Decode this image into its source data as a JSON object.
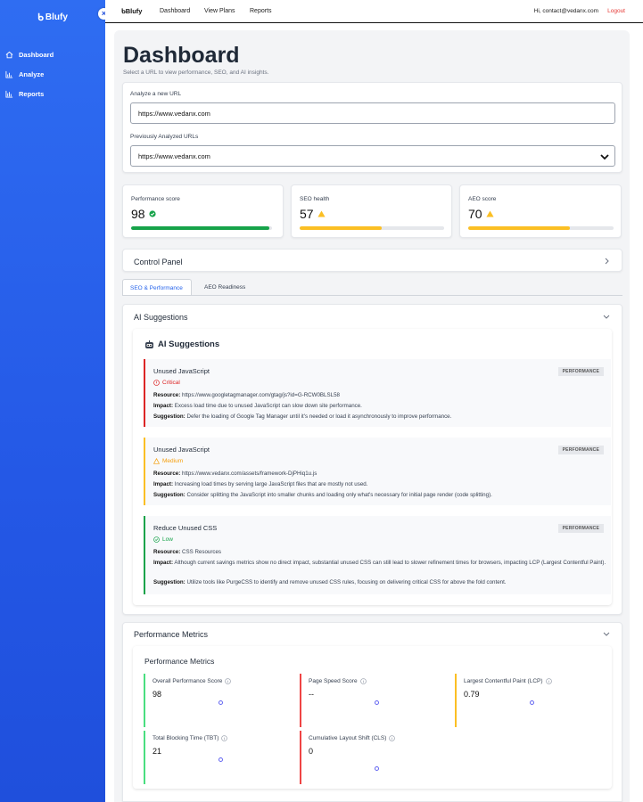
{
  "sidebar": {
    "logo": "Blufy",
    "close": "×",
    "items": [
      {
        "label": "Dashboard",
        "icon": "home-icon"
      },
      {
        "label": "Analyze",
        "icon": "bar-chart-icon"
      },
      {
        "label": "Reports",
        "icon": "bar-chart-icon"
      }
    ]
  },
  "topnav": {
    "logo": "Blufy",
    "links": [
      "Dashboard",
      "View Plans",
      "Reports"
    ],
    "user": "Hi, contact@vedanx.com",
    "logout": "Logout"
  },
  "page": {
    "title": "Dashboard",
    "subtitle": "Select a URL to view performance, SEO, and AI insights."
  },
  "analyze": {
    "new_label": "Analyze a new URL",
    "new_value": "https://www.vedanx.com",
    "prev_label": "Previously Analyzed URLs",
    "prev_value": "https://www.vedanx.com"
  },
  "scores": [
    {
      "label": "Performance score",
      "value": "98",
      "status": "good",
      "fill": 0.98,
      "color": "#16a34a"
    },
    {
      "label": "SEO health",
      "value": "57",
      "status": "warn",
      "fill": 0.57,
      "color": "#fbbf24"
    },
    {
      "label": "AEO score",
      "value": "70",
      "status": "warn",
      "fill": 0.7,
      "color": "#fbbf24"
    }
  ],
  "control_panel": {
    "title": "Control Panel"
  },
  "tabs": [
    "SEO & Performance",
    "AEO Readiness"
  ],
  "ai_section": {
    "title": "AI Suggestions",
    "inner_title": "AI Suggestions",
    "suggestions": [
      {
        "title": "Unused JavaScript",
        "severity": "Critical",
        "color": "#dc2626",
        "tag": "PERFORMANCE",
        "resource_label": "Resource:",
        "resource": "https://www.googletagmanager.com/gtag/js?id=G-RCW0BLSL58",
        "impact_label": "Impact:",
        "impact": "Excess load time due to unused JavaScript can slow down site performance.",
        "suggestion_label": "Suggestion:",
        "suggestion": "Defer the loading of Google Tag Manager until it's needed or load it asynchronously to improve performance."
      },
      {
        "title": "Unused JavaScript",
        "severity": "Medium",
        "color": "#fbbf24",
        "tag": "PERFORMANCE",
        "resource_label": "Resource:",
        "resource": "https://www.vedanx.com/assets/framework-DjPHiq1u.js",
        "impact_label": "Impact:",
        "impact": "Increasing load times by serving large JavaScript files that are mostly not used.",
        "suggestion_label": "Suggestion:",
        "suggestion": "Consider splitting the JavaScript into smaller chunks and loading only what's necessary for initial page render (code splitting)."
      },
      {
        "title": "Reduce Unused CSS",
        "severity": "Low",
        "color": "#16a34a",
        "tag": "PERFORMANCE",
        "resource_label": "Resource:",
        "resource": "CSS Resources",
        "impact_label": "Impact:",
        "impact": "Although current savings metrics show no direct impact, substantial unused CSS can still lead to slower refinement times for browsers, impacting LCP (Largest Contentful Paint).",
        "suggestion_label": "Suggestion:",
        "suggestion": "Utilize tools like PurgeCSS to identify and remove unused CSS rules, focusing on delivering critical CSS for above the fold content."
      }
    ]
  },
  "perf_section": {
    "title": "Performance Metrics",
    "inner_title": "Performance Metrics",
    "metrics": [
      {
        "name": "Overall Performance Score",
        "value": "98",
        "color": "#4ade80"
      },
      {
        "name": "Page Speed Score",
        "value": "--",
        "color": "#ef4444"
      },
      {
        "name": "Largest Contentful Paint (LCP)",
        "value": "0.79",
        "color": "#fbbf24"
      },
      {
        "name": "Total Blocking Time (TBT)",
        "value": "21",
        "color": "#4ade80"
      },
      {
        "name": "Cumulative Layout Shift (CLS)",
        "value": "0",
        "color": "#ef4444"
      }
    ]
  }
}
